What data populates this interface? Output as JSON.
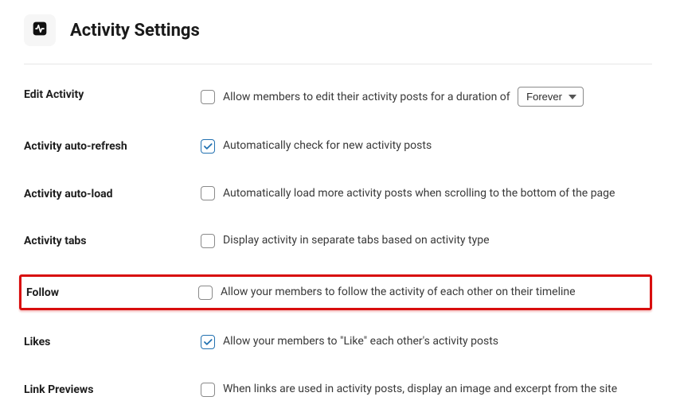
{
  "header": {
    "title": "Activity Settings",
    "icon_name": "activity-icon"
  },
  "settings": {
    "edit_activity": {
      "label": "Edit Activity",
      "text": "Allow members to edit their activity posts for a duration of",
      "checked": false,
      "duration_selected": "Forever"
    },
    "auto_refresh": {
      "label": "Activity auto-refresh",
      "text": "Automatically check for new activity posts",
      "checked": true
    },
    "auto_load": {
      "label": "Activity auto-load",
      "text": "Automatically load more activity posts when scrolling to the bottom of the page",
      "checked": false
    },
    "tabs": {
      "label": "Activity tabs",
      "text": "Display activity in separate tabs based on activity type",
      "checked": false
    },
    "follow": {
      "label": "Follow",
      "text": "Allow your members to follow the activity of each other on their timeline",
      "checked": false
    },
    "likes": {
      "label": "Likes",
      "text": "Allow your members to \"Like\" each other's activity posts",
      "checked": true
    },
    "link_previews": {
      "label": "Link Previews",
      "text": "When links are used in activity posts, display an image and excerpt from the site",
      "checked": false
    }
  }
}
